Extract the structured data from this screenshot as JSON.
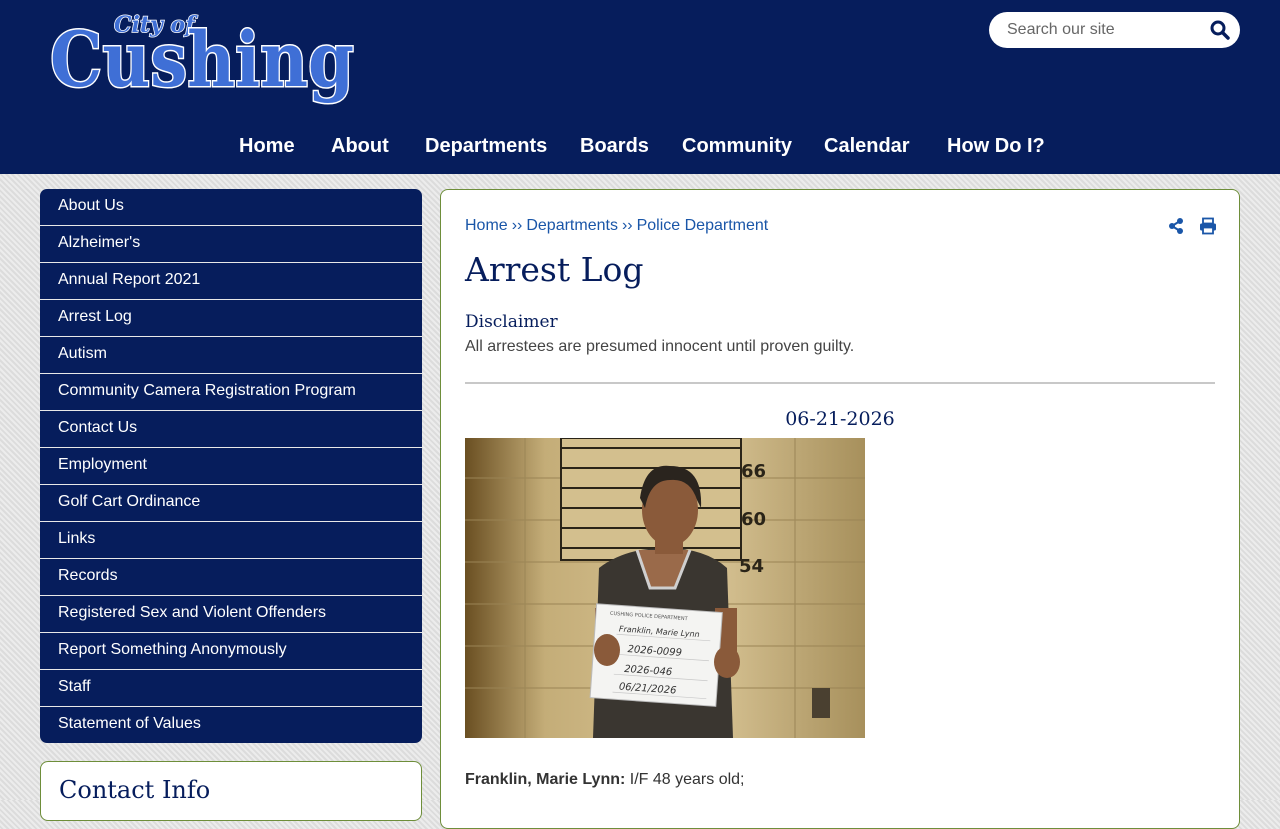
{
  "header": {
    "logo_small": "City of",
    "logo_big": "Cushing",
    "search_placeholder": "Search our site"
  },
  "nav": [
    "Home",
    "About",
    "Departments",
    "Boards",
    "Community",
    "Calendar",
    "How Do I?"
  ],
  "sidebar": {
    "items": [
      "About Us",
      "Alzheimer's",
      "Annual Report 2021",
      "Arrest Log",
      "Autism",
      "Community Camera Registration Program",
      "Contact Us",
      "Employment",
      "Golf Cart Ordinance",
      "Links",
      "Records",
      "Registered Sex and Violent Offenders",
      "Report Something Anonymously",
      "Staff",
      "Statement of Values"
    ],
    "contact_title": "Contact Info"
  },
  "breadcrumb": [
    "Home",
    "Departments",
    "Police Department"
  ],
  "page": {
    "title": "Arrest Log",
    "disclaimer_heading": "Disclaimer",
    "disclaimer_text": "All arrestees are presumed innocent until proven guilty.",
    "entry_date": "06-21-2026",
    "entry_name": "Franklin, Marie Lynn:",
    "entry_details": "I/F 48 years old;"
  },
  "mugshot": {
    "height_marks": [
      "66",
      "60",
      "54"
    ],
    "sign_header": "CUSHING POLICE DEPARTMENT",
    "sign_name": "Franklin, Marie Lynn",
    "sign_booking": "2026-0099",
    "sign_case": "2026-046",
    "sign_date": "06/21/2026"
  },
  "colors": {
    "brand_navy": "#061d5c",
    "link_blue": "#1a56a8",
    "frame_green": "#6e8e3a",
    "logo_blue": "#3f6fd6"
  }
}
